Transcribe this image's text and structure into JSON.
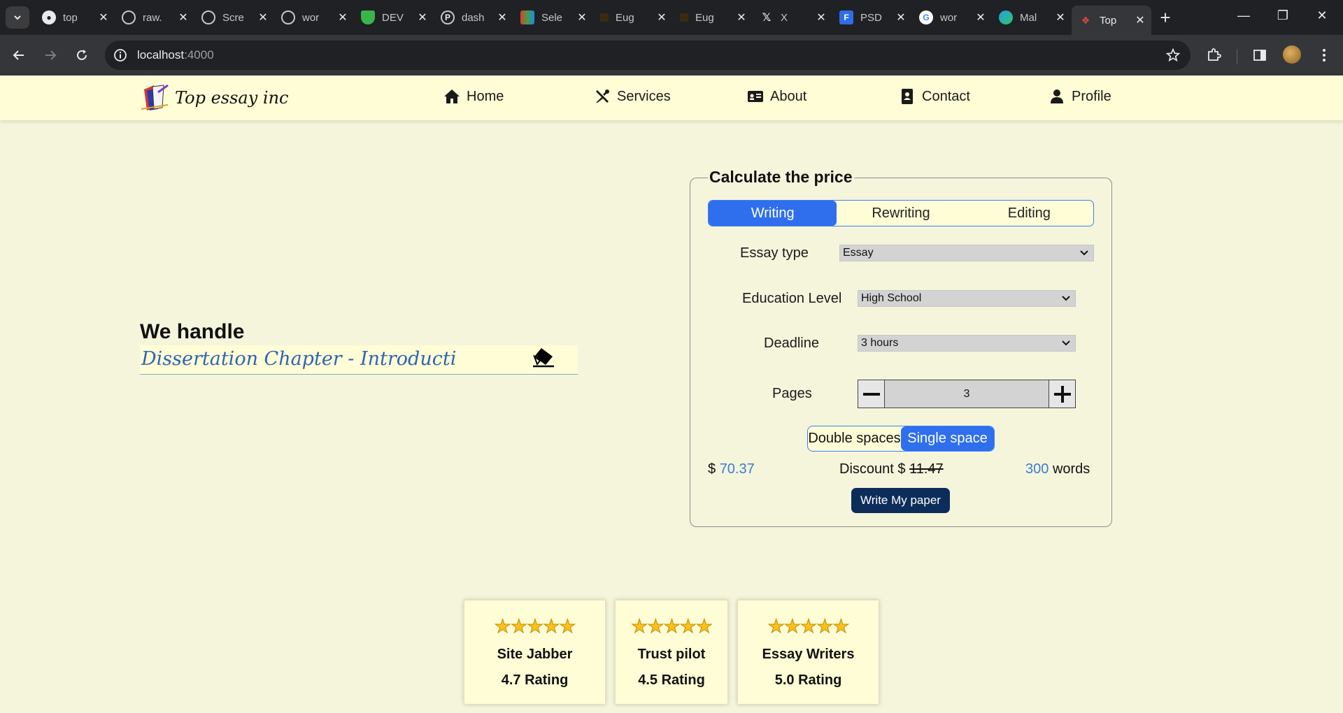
{
  "browser": {
    "tabs": [
      {
        "title": "top",
        "icon": "github-icon"
      },
      {
        "title": "raw.",
        "icon": "globe-icon"
      },
      {
        "title": "Scre",
        "icon": "globe-icon"
      },
      {
        "title": "wor",
        "icon": "globe-icon"
      },
      {
        "title": "DEV",
        "icon": "shield-icon"
      },
      {
        "title": "dash",
        "icon": "p-logo-icon"
      },
      {
        "title": "Sele",
        "icon": "colorful-logo-icon"
      },
      {
        "title": "Eug",
        "icon": "doc-icon"
      },
      {
        "title": "Eug",
        "icon": "doc-icon"
      },
      {
        "title": "X",
        "icon": "x-logo-icon"
      },
      {
        "title": "PSD",
        "icon": "psd-icon"
      },
      {
        "title": "wor",
        "icon": "google-icon"
      },
      {
        "title": "Mal",
        "icon": "edge-icon"
      },
      {
        "title": "Top",
        "icon": "site-logo-icon"
      }
    ],
    "url_host": "localhost",
    "url_port": ":4000"
  },
  "site": {
    "logo_text": "Top essay inc",
    "nav": [
      {
        "label": "Home",
        "icon": "home-icon"
      },
      {
        "label": "Services",
        "icon": "tools-icon"
      },
      {
        "label": "About",
        "icon": "id-card-icon"
      },
      {
        "label": "Contact",
        "icon": "contact-book-icon"
      },
      {
        "label": "Profile",
        "icon": "user-icon"
      }
    ]
  },
  "hero": {
    "heading": "We handle",
    "typing_text": "Dissertation Chapter - Introducti"
  },
  "calculator": {
    "title": "Calculate the price",
    "modes": [
      "Writing",
      "Rewriting",
      "Editing"
    ],
    "active_mode": "Writing",
    "essay_type_label": "Essay type",
    "essay_type_value": "Essay",
    "education_label": "Education Level",
    "education_value": "High School",
    "deadline_label": "Deadline",
    "deadline_value": "3 hours",
    "pages_label": "Pages",
    "pages_value": "3",
    "spacing_options": [
      "Double spaces",
      "Single space"
    ],
    "active_spacing": "Single space",
    "currency": "$",
    "price": "70.37",
    "discount_label": "Discount $",
    "discount_value": "11.47",
    "words_count": "300",
    "words_label": "words",
    "cta": "Write My paper"
  },
  "ratings": [
    {
      "name": "Site Jabber",
      "rating": "4.7 Rating",
      "stars": 5
    },
    {
      "name": "Trust pilot",
      "rating": "4.5 Rating",
      "stars": 5
    },
    {
      "name": "Essay Writers",
      "rating": "5.0 Rating",
      "stars": 5
    }
  ],
  "colors": {
    "page_bg": "#f5f5dc",
    "header_bg": "#fffdd6",
    "accent": "#2f6fed",
    "cta_bg": "#0c2d5a",
    "star": "#f6c21c"
  }
}
